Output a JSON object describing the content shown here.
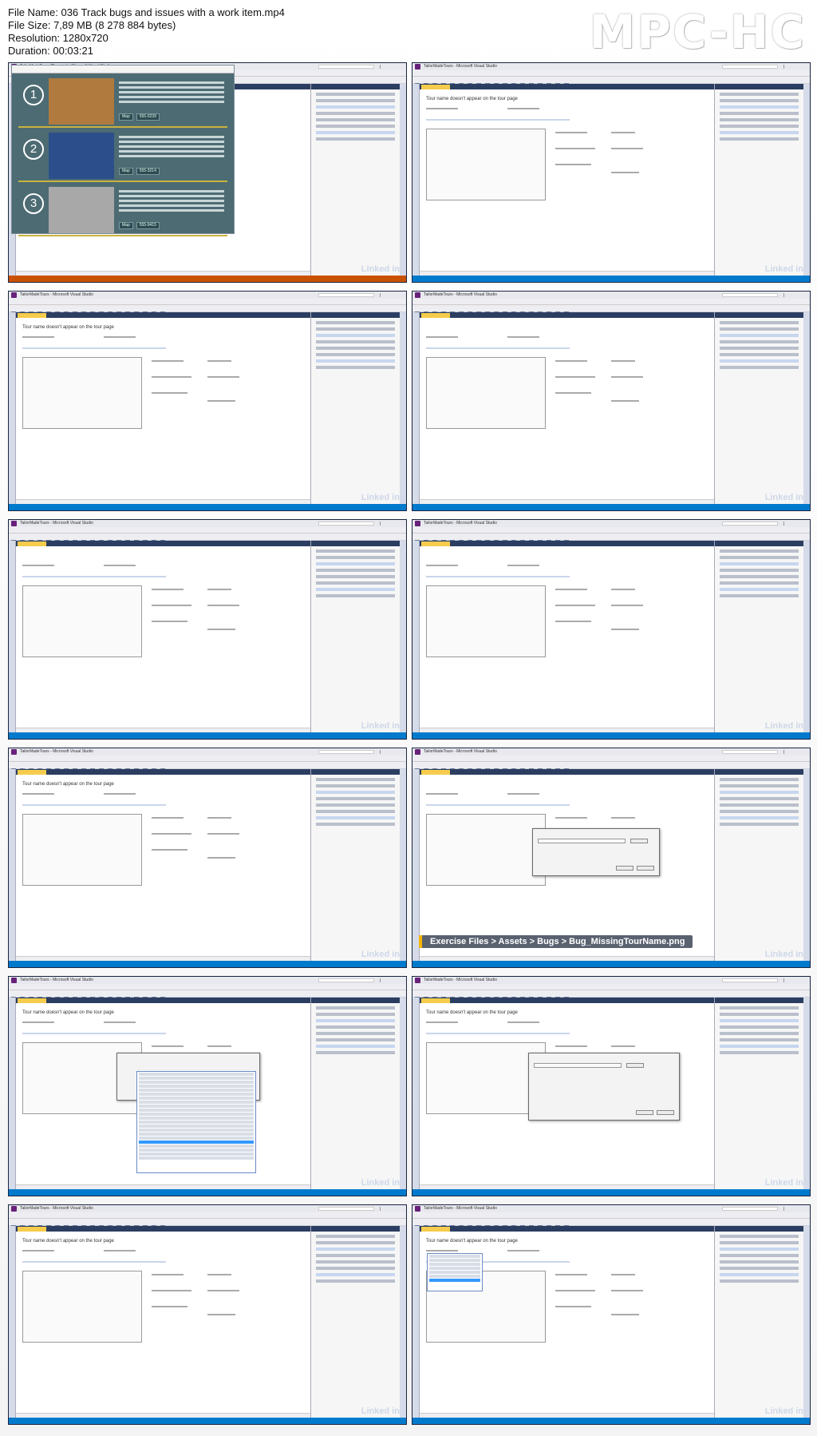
{
  "header": {
    "file_name": "File Name: 036 Track bugs and issues with a work item.mp4",
    "file_size": "File Size: 7,89 MB (8 278 884 bytes)",
    "resolution": "Resolution: 1280x720",
    "duration": "Duration: 00:03:21"
  },
  "logo_text": "MPC-HC",
  "frames": [
    {
      "title": "TailorMadeTours (Running) - Microsoft Visual Studio",
      "watermark": "Linked in",
      "has_app": true,
      "app_items": [
        {
          "number": "1",
          "btn1": "Map",
          "btn2": "555-0239"
        },
        {
          "number": "2",
          "btn1": "Map",
          "btn2": "555-3214"
        },
        {
          "number": "3",
          "btn1": "Map",
          "btn2": "555-9415"
        }
      ]
    },
    {
      "title": "TailorMadeTours - Microsoft Visual Studio",
      "watermark": "Linked in",
      "form_title": "Tour name doesn't appear on the tour page"
    },
    {
      "title": "TailorMadeTours - Microsoft Visual Studio",
      "watermark": "Linked in",
      "form_title": "Tour name doesn't appear on the tour page"
    },
    {
      "title": "TailorMadeTours - Microsoft Visual Studio",
      "watermark": "Linked in",
      "form_title": ""
    },
    {
      "title": "TailorMadeTours - Microsoft Visual Studio",
      "watermark": "Linked in",
      "form_title": ""
    },
    {
      "title": "TailorMadeTours - Microsoft Visual Studio",
      "watermark": "Linked in",
      "form_title": ""
    },
    {
      "title": "TailorMadeTours - Microsoft Visual Studio",
      "watermark": "Linked in",
      "form_title": "Tour name doesn't appear on the tour page"
    },
    {
      "title": "TailorMadeTours - Microsoft Visual Studio",
      "watermark": "Linked in",
      "form_title": "",
      "tooltip": "Exercise Files > Assets > Bugs > Bug_MissingTourName.png"
    },
    {
      "title": "TailorMadeTours - Microsoft Visual Studio",
      "watermark": "Linked in",
      "form_title": "Tour name doesn't appear on the tour page"
    },
    {
      "title": "TailorMadeTours - Microsoft Visual Studio",
      "watermark": "Linked in",
      "form_title": "Tour name doesn't appear on the tour page"
    },
    {
      "title": "TailorMadeTours - Microsoft Visual Studio",
      "watermark": "Linked in",
      "form_title": "Tour name doesn't appear on the tour page"
    },
    {
      "title": "TailorMadeTours - Microsoft Visual Studio",
      "watermark": "Linked in",
      "form_title": "Tour name doesn't appear on the tour page"
    }
  ],
  "colors": {
    "vs_statusbar_blue": "#007acc",
    "vs_statusbar_orange": "#ca5100",
    "vs_tab_yellow": "#f5cc4c",
    "vs_dark_navy": "#2b3e61"
  }
}
